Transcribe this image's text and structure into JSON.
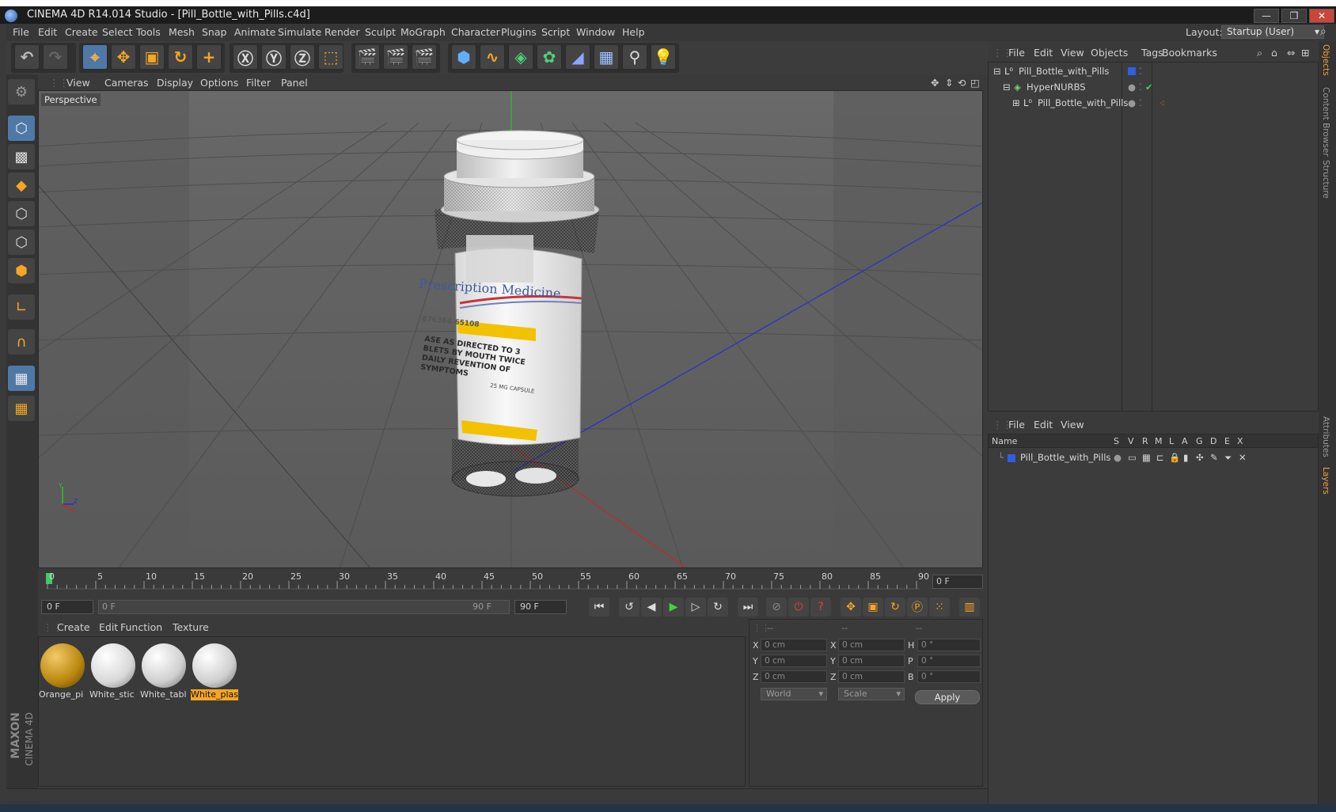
{
  "window": {
    "title": "CINEMA 4D R14.014 Studio - [Pill_Bottle_with_Pills.c4d]",
    "minimize": "—",
    "restore": "❐",
    "close": "✕"
  },
  "menubar": {
    "items": [
      "File",
      "Edit",
      "Create",
      "Select",
      "Tools",
      "Mesh",
      "Snap",
      "Animate",
      "Simulate",
      "Render",
      "Sculpt",
      "MoGraph",
      "Character",
      "Plugins",
      "Script",
      "Window",
      "Help"
    ],
    "layout_label": "Layout:",
    "layout_value": "Startup (User)"
  },
  "viewport": {
    "menu": [
      "View",
      "Cameras",
      "Display",
      "Options",
      "Filter",
      "Panel"
    ],
    "label": "Perspective",
    "bottle_label_title": "Prescription Medicine",
    "bottle_label_rx": "876364-65108",
    "bottle_label_text": "ASE AS DIRECTED TO 3 BLETS BY MOUTH TWICE DAILY REVENTION OF SYMPTOMS",
    "bottle_label_dose": "25 MG CAPSULE",
    "axis_x": "X",
    "axis_y": "Y",
    "axis_z": "Z"
  },
  "timeline": {
    "ticks": [
      "0",
      "5",
      "10",
      "15",
      "20",
      "25",
      "30",
      "35",
      "40",
      "45",
      "50",
      "55",
      "60",
      "65",
      "70",
      "75",
      "80",
      "85",
      "90"
    ],
    "current_frame": "0 F"
  },
  "transport": {
    "start_field": "0 F",
    "range_start": "0 F",
    "range_end": "90 F",
    "end_field": "90 F"
  },
  "materials": {
    "menu": [
      "Create",
      "Edit",
      "Function",
      "Texture"
    ],
    "items": [
      {
        "label": "Orange_pi",
        "color": "#b8860b"
      },
      {
        "label": "White_stic",
        "color": "#d8d8d8"
      },
      {
        "label": "White_tabl",
        "color": "#cfcfcf"
      },
      {
        "label": "White_plas",
        "color": "#cfcfcf"
      }
    ]
  },
  "coordinates": {
    "headers": [
      "--",
      "--",
      "--"
    ],
    "row_x": {
      "label1": "X",
      "value1": "0 cm",
      "label2": "X",
      "value2": "0 cm",
      "label3": "H",
      "value3": "0 °"
    },
    "row_y": {
      "label1": "Y",
      "value1": "0 cm",
      "label2": "Y",
      "value2": "0 cm",
      "label3": "P",
      "value3": "0 °"
    },
    "row_z": {
      "label1": "Z",
      "value1": "0 cm",
      "label2": "Z",
      "value2": "0 cm",
      "label3": "B",
      "value3": "0 °"
    },
    "space_select": "World",
    "mode_select": "Scale",
    "apply": "Apply"
  },
  "object_manager": {
    "menu": [
      "File",
      "Edit",
      "View",
      "Objects",
      "Tags",
      "Bookmarks"
    ],
    "objects": [
      "Pill_Bottle_with_Pills",
      "HyperNURBS",
      "Pill_Bottle_with_Pills"
    ]
  },
  "layer_manager": {
    "menu": [
      "File",
      "Edit",
      "View"
    ],
    "columns": [
      "Name",
      "S",
      "V",
      "R",
      "M",
      "L",
      "A",
      "G",
      "D",
      "E",
      "X"
    ],
    "layers": [
      "Pill_Bottle_with_Pills"
    ]
  },
  "right_tabs": [
    "Objects",
    "Content Browser",
    "Structure",
    "Attributes",
    "Layers"
  ],
  "brand": {
    "line1": "MAXON",
    "line2": "CINEMA 4D"
  },
  "colors": {
    "accent": "#4f78a6",
    "selected_material": "#f5a623",
    "layer_blue": "#2f5fe0"
  }
}
